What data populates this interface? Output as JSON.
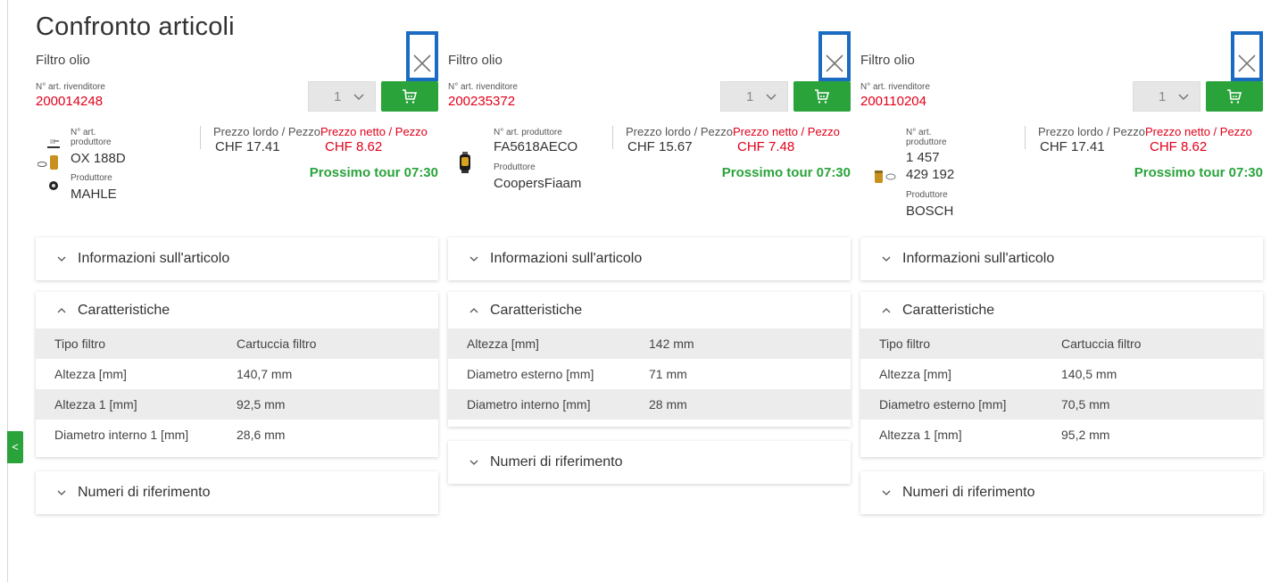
{
  "page": {
    "title": "Confronto articoli"
  },
  "labels": {
    "dealer_no": "N° art. rivenditore",
    "gross": "Prezzo lordo / Pezzo",
    "net": "Prezzo netto / Pezzo",
    "manufacturer": "Produttore",
    "article_info": "Informazioni sull'articolo",
    "characteristics": "Caratteristiche",
    "reference_numbers": "Numeri di riferimento"
  },
  "colors": {
    "accent_red": "#e1001a",
    "accent_green": "#2aa33b",
    "focus_blue": "#1a6bc1"
  },
  "icons": {
    "close": "close-icon",
    "cart": "cart-icon",
    "chevron_down": "chevron-down-icon",
    "chevron_up": "chevron-up-icon",
    "side_tab": "chevron-left-icon"
  },
  "side_tab": {
    "glyph": "<"
  },
  "articles": [
    {
      "name": "Filtro olio",
      "dealer_number": "200014248",
      "quantity": "1",
      "mfr_no_label": "N° art. produttore",
      "mfr_no": "OX 188D",
      "manufacturer": "MAHLE",
      "gross_price": "CHF 17.41",
      "net_price": "CHF 8.62",
      "tour": "Prossimo tour 07:30",
      "characteristics": [
        {
          "key": "Tipo filtro",
          "value": "Cartuccia filtro"
        },
        {
          "key": "Altezza [mm]",
          "value": "140,7 mm"
        },
        {
          "key": "Altezza 1 [mm]",
          "value": "92,5 mm"
        },
        {
          "key": "Diametro interno 1 [mm]",
          "value": "28,6 mm"
        }
      ]
    },
    {
      "name": "Filtro olio",
      "dealer_number": "200235372",
      "quantity": "1",
      "mfr_no_label": "N° art. produttore",
      "mfr_no": "FA5618AECO",
      "manufacturer": "CoopersFiaam",
      "gross_price": "CHF 15.67",
      "net_price": "CHF 7.48",
      "tour": "Prossimo tour 07:30",
      "characteristics": [
        {
          "key": "Altezza [mm]",
          "value": "142 mm"
        },
        {
          "key": "Diametro esterno [mm]",
          "value": "71 mm"
        },
        {
          "key": "Diametro interno [mm]",
          "value": "28 mm"
        }
      ]
    },
    {
      "name": "Filtro olio",
      "dealer_number": "200110204",
      "quantity": "1",
      "mfr_no_label": "N° art. produttore",
      "mfr_no_line1": "1 457",
      "mfr_no_line2": "429 192",
      "manufacturer": "BOSCH",
      "gross_price": "CHF 17.41",
      "net_price": "CHF 8.62",
      "tour": "Prossimo tour 07:30",
      "characteristics": [
        {
          "key": "Tipo filtro",
          "value": "Cartuccia filtro"
        },
        {
          "key": "Altezza [mm]",
          "value": "140,5 mm"
        },
        {
          "key": "Diametro esterno [mm]",
          "value": "70,5 mm"
        },
        {
          "key": "Altezza 1 [mm]",
          "value": "95,2 mm"
        }
      ]
    }
  ]
}
